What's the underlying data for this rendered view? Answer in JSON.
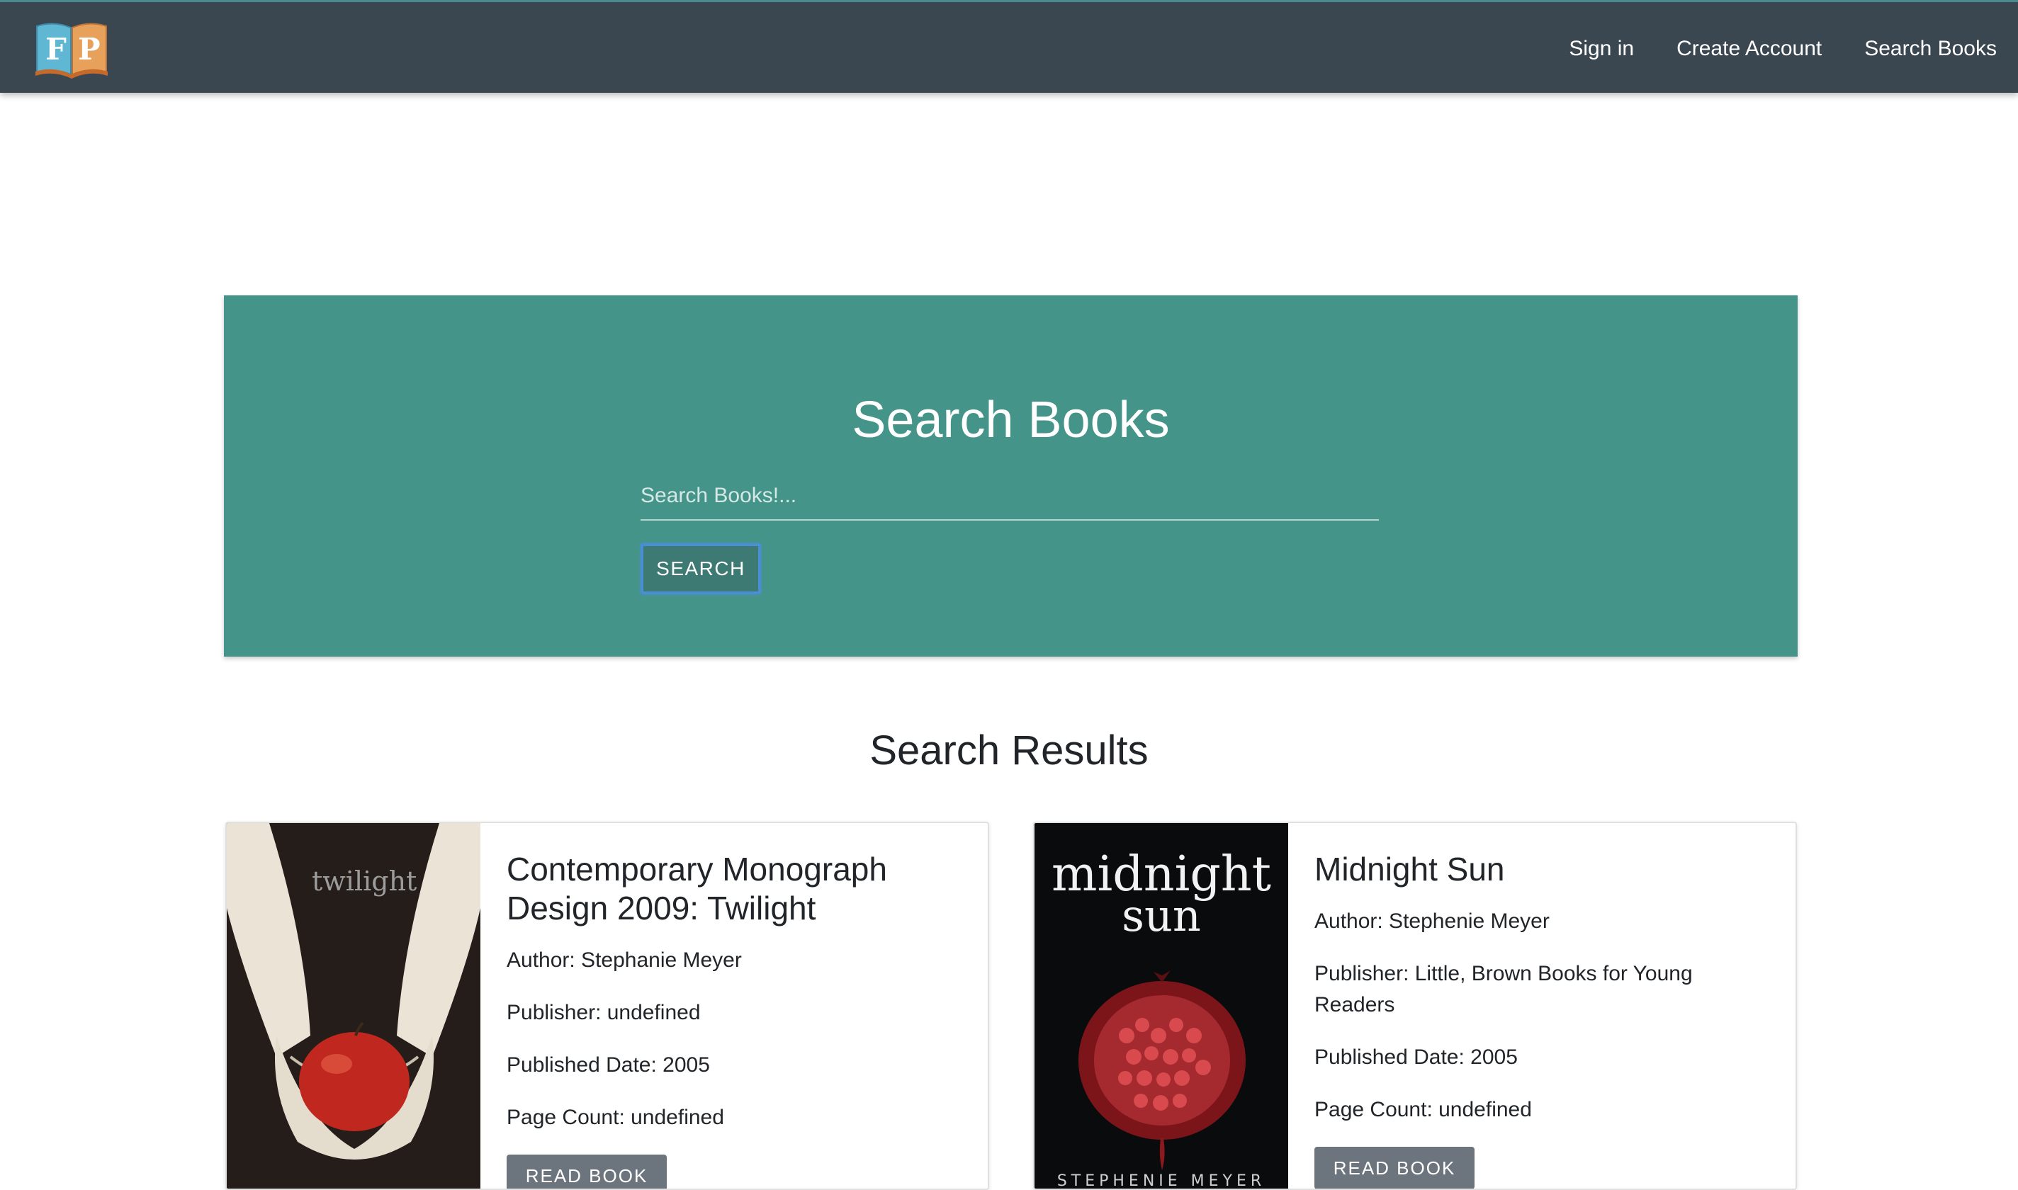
{
  "nav": {
    "logo_letters": [
      "F",
      "P"
    ],
    "links": [
      "Sign in",
      "Create Account",
      "Search Books"
    ]
  },
  "search": {
    "title": "Search Books",
    "placeholder": "Search Books!...",
    "value": "",
    "button_label": "SEARCH"
  },
  "results": {
    "title": "Search Results",
    "books": [
      {
        "title": "Contemporary Monograph Design 2009: Twilight",
        "author": "Author: Stephanie Meyer",
        "publisher": "Publisher: undefined",
        "published": "Published Date: 2005",
        "pages": "Page Count: undefined",
        "button_label": "READ BOOK",
        "cover_text": "twilight"
      },
      {
        "title": "Midnight Sun",
        "author": "Author: Stephenie Meyer",
        "publisher": "Publisher: Little, Brown Books for Young Readers",
        "published": "Published Date: 2005",
        "pages": "Page Count: undefined",
        "button_label": "READ BOOK",
        "cover_text_1": "midnight",
        "cover_text_2": "sun",
        "cover_author": "STEPHENIE MEYER"
      }
    ]
  },
  "colors": {
    "navbar": "#3a4750",
    "panel": "#449489",
    "button_focus": "#4a8fd4",
    "secondary_button": "#6c757d"
  }
}
